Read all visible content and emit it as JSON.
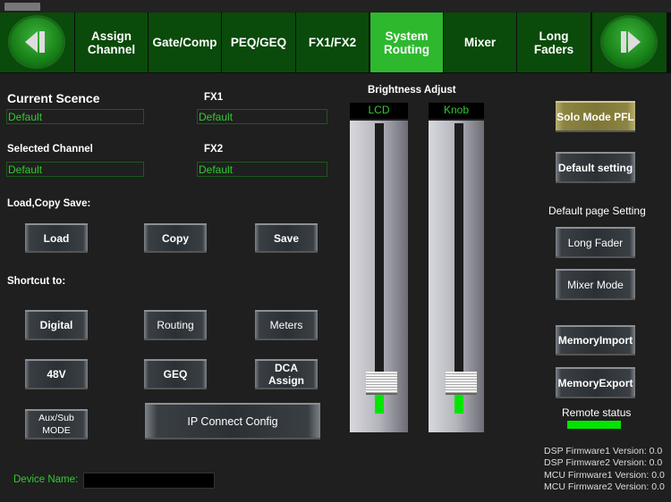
{
  "nav": {
    "tabs": [
      "Assign\nChannel",
      "Gate/Comp",
      "PEQ/GEQ",
      "FX1/FX2",
      "System\nRouting",
      "Mixer",
      "Long\nFaders"
    ],
    "active": 4
  },
  "scene": {
    "current_label": "Current Scence",
    "current_value": "Default",
    "fx1_label": "FX1",
    "fx1_value": "Default",
    "channel_label": "Selected Channel",
    "channel_value": "Default",
    "fx2_label": "FX2",
    "fx2_value": "Default"
  },
  "lcs": {
    "label": "Load,Copy Save:",
    "load": "Load",
    "copy": "Copy",
    "save": "Save"
  },
  "shortcut": {
    "label": "Shortcut to:",
    "digital": "Digital",
    "routing": "Routing",
    "meters": "Meters",
    "v48": "48V",
    "geq": "GEQ",
    "dca": "DCA\nAssign",
    "aux": "Aux/Sub MODE",
    "ip": "IP Connect Config"
  },
  "device": {
    "label": "Device Name:",
    "value": ""
  },
  "brightness": {
    "title": "Brightness Adjust",
    "lcd_label": "LCD",
    "knob_label": "Knob",
    "lcd_level": 0.07,
    "knob_level": 0.07
  },
  "right": {
    "solo": "Solo Mode PFL",
    "default_setting": "Default setting",
    "page_label": "Default page Setting",
    "long_fader": "Long Fader",
    "mixer_mode": "Mixer Mode",
    "mem_import": "MemoryImport",
    "mem_export": "MemoryExport",
    "remote_label": "Remote status",
    "remote_color": "#00e600"
  },
  "firmware": [
    "DSP Firmware1 Version: 0.0",
    "DSP Firmware2 Version: 0.0",
    "MCU Firmware1 Version: 0.0",
    "MCU Firmware2 Version: 0.0"
  ]
}
